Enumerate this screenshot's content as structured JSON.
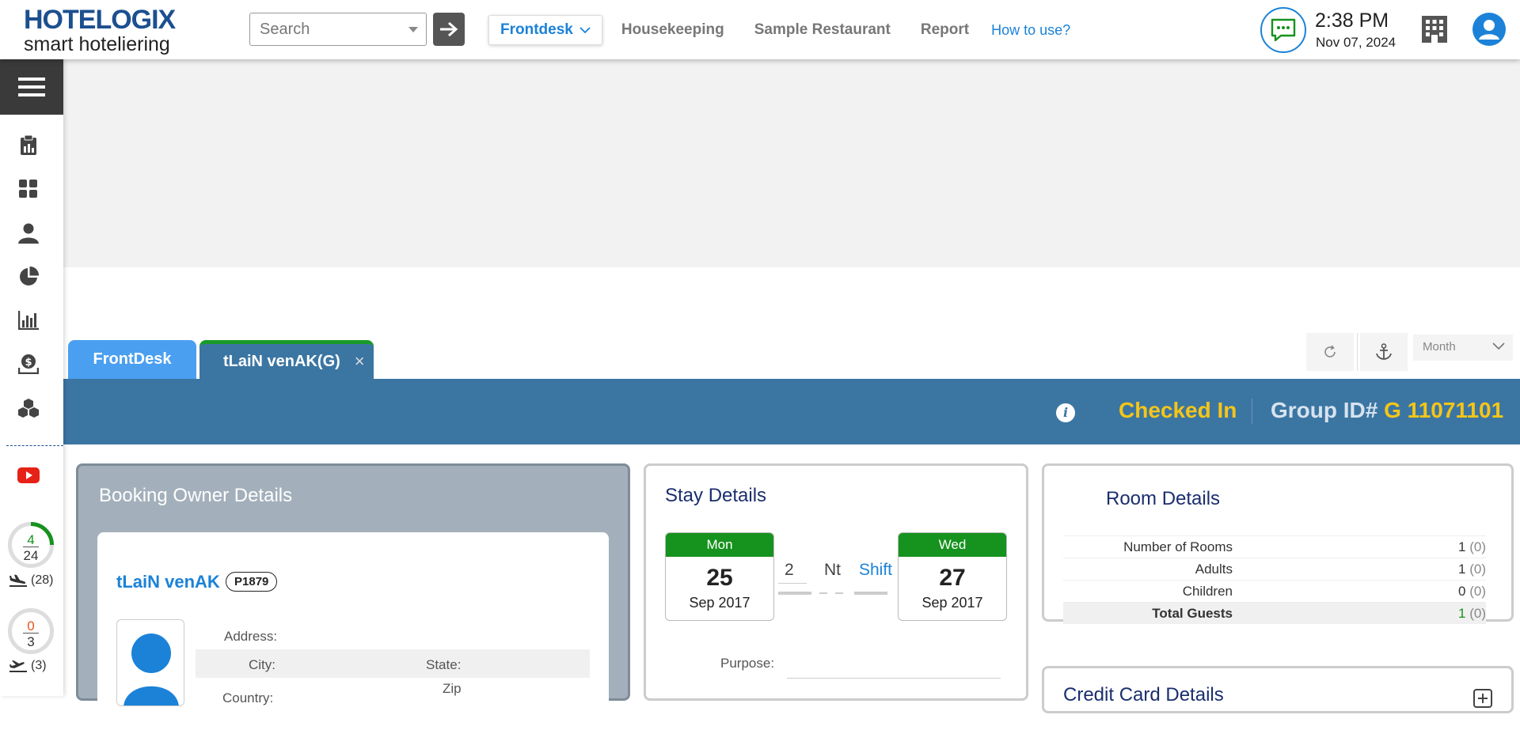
{
  "header": {
    "brand": "HOTELOGIX",
    "tagline": "smart hoteliering",
    "search_placeholder": "Search",
    "nav": {
      "frontdesk": "Frontdesk",
      "housekeeping": "Housekeeping",
      "restaurant": "Sample Restaurant",
      "report": "Report",
      "how_to": "How to use?"
    },
    "time": "2:38 PM",
    "date": "Nov 07, 2024"
  },
  "sidebar": {
    "icons": [
      "menu-icon",
      "clipboard-icon",
      "dashboard-icon",
      "person-icon",
      "pie-chart-icon",
      "bar-chart-icon",
      "money-icon",
      "boxes-icon",
      "youtube-icon"
    ],
    "arrivals": {
      "done": "4",
      "total": "24",
      "pending": "(28)"
    },
    "departures": {
      "done": "0",
      "total": "3",
      "pending": "(3)"
    }
  },
  "tabs": {
    "frontdesk": "FrontDesk",
    "guest": "tLaiN venAK(G)",
    "close": "×"
  },
  "toolbar": {
    "period": "Month"
  },
  "status_bar": {
    "status": "Checked In",
    "group_label": "Group ID#",
    "group_value": "G 11071101"
  },
  "owner": {
    "title": "Booking Owner Details",
    "name": "tLaiN venAK",
    "badge": "P1879",
    "address_label": "Address:",
    "city_label": "City:",
    "state_label": "State:",
    "country_label": "Country:",
    "zip_label": "Zip"
  },
  "stay": {
    "title": "Stay Details",
    "checkin": {
      "weekday": "Mon",
      "day": "25",
      "month": "Sep 2017"
    },
    "checkout": {
      "weekday": "Wed",
      "day": "27",
      "month": "Sep 2017"
    },
    "nights": "2",
    "nights_unit": "Nt",
    "shift_label": "Shift",
    "purpose_label": "Purpose:"
  },
  "room": {
    "title": "Room Details",
    "rows": [
      {
        "label": "Number of Rooms",
        "value": "1",
        "paren": "(0)"
      },
      {
        "label": "Adults",
        "value": "1",
        "paren": "(0)"
      },
      {
        "label": "Children",
        "value": "0",
        "paren": "(0)"
      },
      {
        "label": "Total Guests",
        "value": "1",
        "paren": "(0)"
      }
    ]
  },
  "credit_card": {
    "title": "Credit Card Details"
  },
  "colors": {
    "brand_blue": "#1c4f8f",
    "accent_blue": "#1b82d8",
    "status_bar": "#3b76a3",
    "status_yellow": "#f5c518",
    "green": "#16921e"
  }
}
